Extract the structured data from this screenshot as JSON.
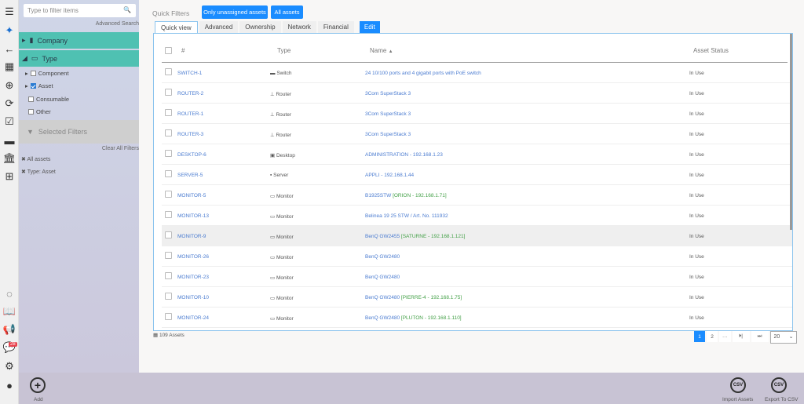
{
  "rail": {
    "badge": "28"
  },
  "sidebar": {
    "filter_placeholder": "Type to filter items",
    "advanced_search": "Advanced Search",
    "groups": [
      {
        "label": "Company"
      },
      {
        "label": "Type"
      }
    ],
    "tree": [
      {
        "label": "Component",
        "checked": false
      },
      {
        "label": "Asset",
        "checked": true
      },
      {
        "label": "Consumable",
        "checked": false
      },
      {
        "label": "Other",
        "checked": false
      }
    ],
    "selected_filters": "Selected Filters",
    "clear_all": "Clear All Filters",
    "chips": [
      "All assets",
      "Type: Asset"
    ]
  },
  "main": {
    "quick_filters": "Quick Filters",
    "qbtns": [
      "Only unassigned assets",
      "All assets"
    ],
    "tabs": [
      "Quick view",
      "Advanced",
      "Ownership",
      "Network",
      "Financial",
      "Edit"
    ],
    "columns": [
      "#",
      "Type",
      "Name",
      "Asset Status"
    ],
    "rows": [
      {
        "id": "SWITCH-1",
        "type": "Switch",
        "name": "24 10/100 ports and 4 gigabit ports with PoE switch",
        "extra": "",
        "status": "In Use"
      },
      {
        "id": "ROUTER-2",
        "type": "Router",
        "name": "3Com SuperStack 3",
        "extra": "",
        "status": "In Use"
      },
      {
        "id": "ROUTER-1",
        "type": "Router",
        "name": "3Com SuperStack 3",
        "extra": "",
        "status": "In Use"
      },
      {
        "id": "ROUTER-3",
        "type": "Router",
        "name": "3Com SuperStack 3",
        "extra": "",
        "status": "In Use"
      },
      {
        "id": "DESKTOP-6",
        "type": "Desktop",
        "name": "ADMINISTRATION - 192.168.1.23",
        "extra": "",
        "status": "In Use"
      },
      {
        "id": "SERVER-5",
        "type": "Server",
        "name": "APPLI - 192.168.1.44",
        "extra": "",
        "status": "In Use"
      },
      {
        "id": "MONITOR-5",
        "type": "Monitor",
        "name": "B1925STW",
        "extra": "[ORION - 192.168.1.71]",
        "status": "In Use"
      },
      {
        "id": "MONITOR-13",
        "type": "Monitor",
        "name": "Belinea 19 25 STW / Art. No. 111932",
        "extra": "",
        "status": "In Use"
      },
      {
        "id": "MONITOR-9",
        "type": "Monitor",
        "name": "BenQ GW2455",
        "extra": "[SATURNE - 192.168.1.121]",
        "status": "In Use"
      },
      {
        "id": "MONITOR-26",
        "type": "Monitor",
        "name": "BenQ GW2480",
        "extra": "",
        "status": "In Use"
      },
      {
        "id": "MONITOR-23",
        "type": "Monitor",
        "name": "BenQ GW2480",
        "extra": "",
        "status": "In Use"
      },
      {
        "id": "MONITOR-10",
        "type": "Monitor",
        "name": "BenQ GW2480",
        "extra": "[PIERRE-4 - 192.168.1.75]",
        "status": "In Use"
      },
      {
        "id": "MONITOR-24",
        "type": "Monitor",
        "name": "BenQ GW2480",
        "extra": "[PLUTON - 192.168.1.110]",
        "status": "In Use"
      }
    ],
    "count": "109 Assets",
    "pager": [
      "1",
      "2",
      "···",
      "⏭",
      "⏭"
    ],
    "page_size": "20"
  },
  "footer": {
    "add": "Add",
    "import": "Import Assets",
    "export": "Export To CSV"
  }
}
